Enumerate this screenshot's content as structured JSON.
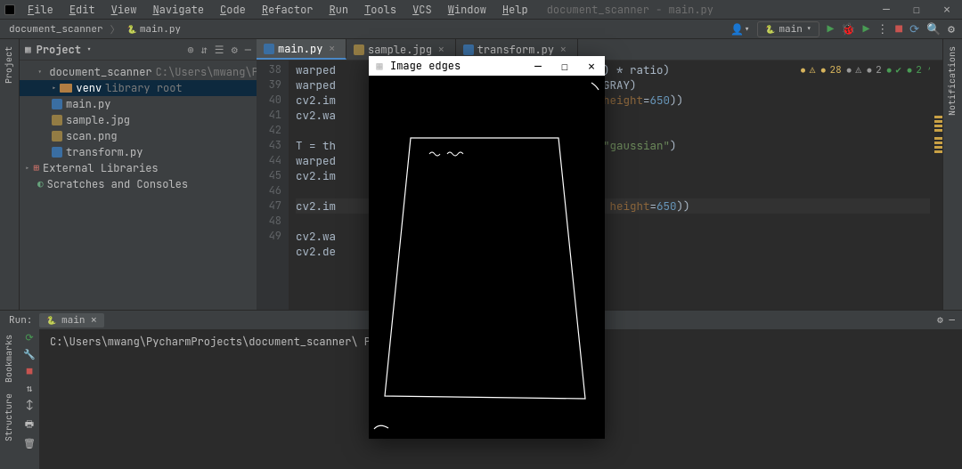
{
  "titleProject": "document_scanner - main.py",
  "menu": [
    "File",
    "Edit",
    "View",
    "Navigate",
    "Code",
    "Refactor",
    "Run",
    "Tools",
    "VCS",
    "Window",
    "Help"
  ],
  "breadcrumbs": [
    "document_scanner",
    "main.py"
  ],
  "runConfig": "main",
  "project": {
    "headerTitle": "Project",
    "rootName": "document_scanner",
    "rootPath": "C:\\Users\\mwang\\PycharmProjects",
    "venv": "venv",
    "venvHint": "library root",
    "files": [
      "main.py",
      "sample.jpg",
      "scan.png",
      "transform.py"
    ],
    "extLib": "External Libraries",
    "scratch": "Scratches and Consoles"
  },
  "tabs": [
    "main.py",
    "sample.jpg",
    "transform.py"
  ],
  "gutterStart": 38,
  "codeLines": [
    "warped                                     , 2) * ratio)",
    "warped                                     GR2GRAY)",
    "cv2.im                                     e, height=650))",
    "cv2.wa",
    "",
    "T = th                                     od=\"gaussian\")",
    "warped",
    "cv2.im",
    "",
    "cv2.im                                     ed, height=650))",
    "cv2.wa",
    "cv2.de"
  ],
  "inspections": {
    "warn": "28",
    "typo": "2",
    "ok": "2"
  },
  "popupTitle": "Image edges",
  "run": {
    "label": "Run:",
    "config": "main",
    "line": "C:\\Users\\mwang\\PycharmProjects\\document_scanner\\                          Projects\\document_scanner\\main.py"
  },
  "sideTabs": {
    "left": [
      "Project",
      "Bookmarks",
      "Structure"
    ],
    "right": "Notifications"
  }
}
